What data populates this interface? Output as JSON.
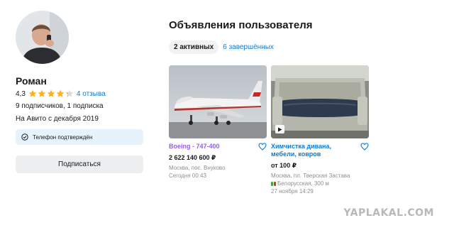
{
  "profile": {
    "name": "Роман",
    "rating_value": "4,3",
    "stars_filled": 4.3,
    "stars_total": 5,
    "reviews_link": "4 отзыва",
    "followers_text": "9 подписчиков, 1 подписка",
    "since_text": "На Авито с декабря 2019",
    "phone_confirmed": "Телефон подтверждён",
    "subscribe_label": "Подписаться"
  },
  "listings": {
    "title": "Объявления пользователя",
    "tab_active": "2 активных",
    "tab_completed": "6 завершённых",
    "items": [
      {
        "title": "Boeing - 747-400",
        "price": "2 622 140 600 ₽",
        "location": "Москва, пос. Внуково",
        "date": "Сегодня 00:43",
        "title_color": "#965eeb"
      },
      {
        "title": "Химчистка дивана, мебели, ковров",
        "price": "от 100 ₽",
        "location": "Москва, пл. Тверская Застава",
        "metro": "Белорусская, 300 м",
        "date": "27 ноября 14:29",
        "title_color": "#0a7bd7",
        "has_video": true
      }
    ]
  },
  "watermark": "YAPLAKAL.COM",
  "colors": {
    "link": "#0a7bd7",
    "star": "#ffb021",
    "badge_bg": "#e6f3fd",
    "button_bg": "#eceef0"
  }
}
